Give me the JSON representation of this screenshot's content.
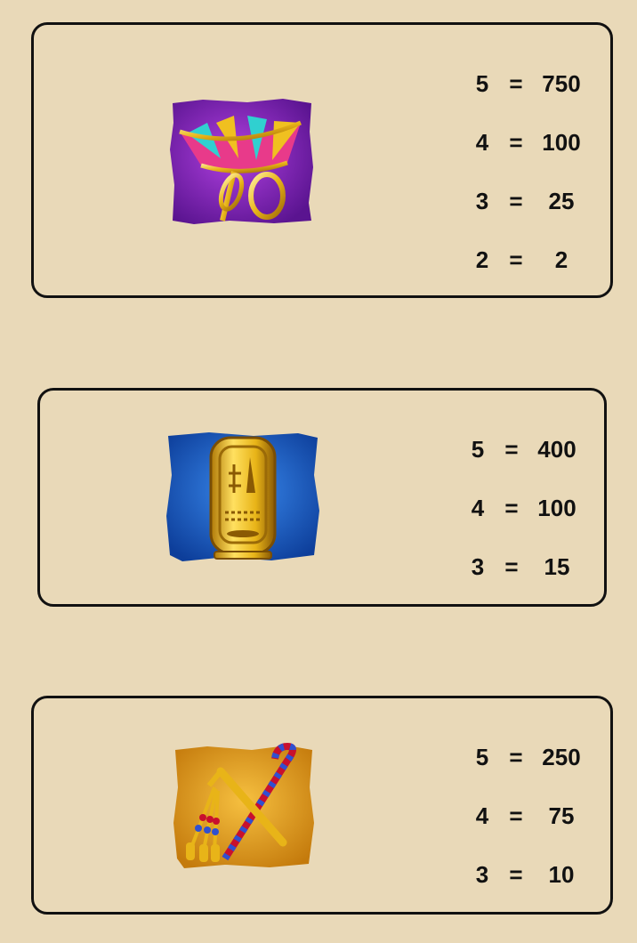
{
  "paytable": [
    {
      "symbol_icon": "lotus-flower-icon",
      "rows": [
        {
          "count": "5",
          "eq": "=",
          "value": "750"
        },
        {
          "count": "4",
          "eq": "=",
          "value": "100"
        },
        {
          "count": "3",
          "eq": "=",
          "value": "25"
        },
        {
          "count": "2",
          "eq": "=",
          "value": "2"
        }
      ]
    },
    {
      "symbol_icon": "golden-cartouche-icon",
      "rows": [
        {
          "count": "5",
          "eq": "=",
          "value": "400"
        },
        {
          "count": "4",
          "eq": "=",
          "value": "100"
        },
        {
          "count": "3",
          "eq": "=",
          "value": "15"
        }
      ]
    },
    {
      "symbol_icon": "crook-and-flail-icon",
      "rows": [
        {
          "count": "5",
          "eq": "=",
          "value": "250"
        },
        {
          "count": "4",
          "eq": "=",
          "value": "75"
        },
        {
          "count": "3",
          "eq": "=",
          "value": "10"
        }
      ]
    }
  ],
  "colors": {
    "background": "#e9d9b8",
    "border": "#111111",
    "lotus_tile": "#7a1fb0",
    "cartouche_tile": "#1f64c8",
    "crook_tile": "#e29a1c",
    "gold": "#e8b418"
  }
}
